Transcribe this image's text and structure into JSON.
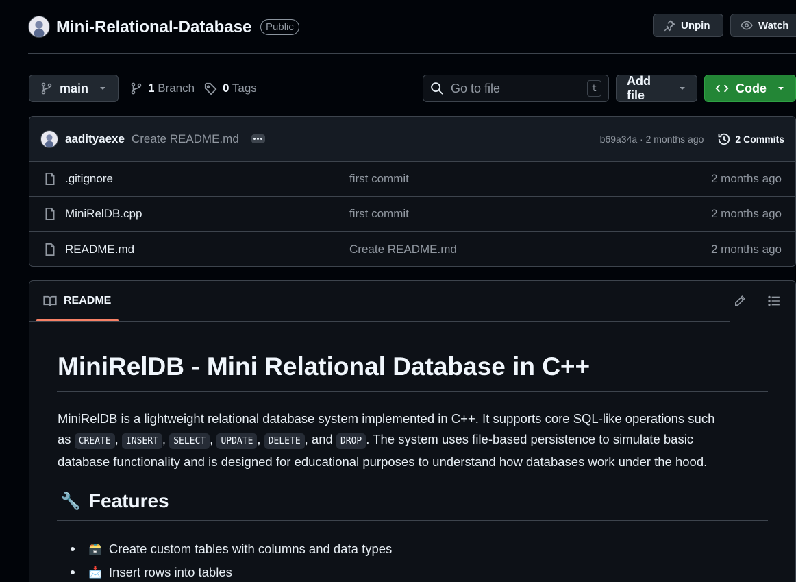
{
  "header": {
    "repo_name": "Mini-Relational-Database",
    "visibility": "Public",
    "unpin_label": "Unpin",
    "watch_label": "Watch"
  },
  "toolbar": {
    "branch": "main",
    "branch_count": "1",
    "branch_label": "Branch",
    "tag_count": "0",
    "tag_label": "Tags",
    "search_placeholder": "Go to file",
    "search_shortcut": "t",
    "add_file_label": "Add file",
    "code_label": "Code"
  },
  "latest_commit": {
    "author": "aadityaexe",
    "message": "Create README.md",
    "hash_time": "b69a34a · 2 months ago",
    "commits_label": "2 Commits"
  },
  "files": [
    {
      "name": ".gitignore",
      "message": "first commit",
      "time": "2 months ago"
    },
    {
      "name": "MiniRelDB.cpp",
      "message": "first commit",
      "time": "2 months ago"
    },
    {
      "name": "README.md",
      "message": "Create README.md",
      "time": "2 months ago"
    }
  ],
  "readme": {
    "tab_label": "README",
    "h1": "MiniRelDB - Mini Relational Database in C++",
    "p_line1": "MiniRelDB is a lightweight relational database system implemented in C++. It supports core SQL-like operations such",
    "p_as": "as",
    "codes": [
      "CREATE",
      "INSERT",
      "SELECT",
      "UPDATE",
      "DELETE",
      "DROP"
    ],
    "p_comma": ",",
    "p_and": ", and",
    "p_after": ". The system uses file-based persistence to simulate basic",
    "p_line3": "database functionality and is designed for educational purposes to understand how databases work under the hood.",
    "features_icon": "🔧",
    "features_heading": "Features",
    "features": [
      {
        "emoji": "🗃️",
        "text": "Create custom tables with columns and data types"
      },
      {
        "emoji": "📩",
        "text": "Insert rows into tables"
      }
    ]
  },
  "colors": {
    "accent_green": "#238636",
    "tab_underline": "#f78166",
    "background": "#010409"
  }
}
